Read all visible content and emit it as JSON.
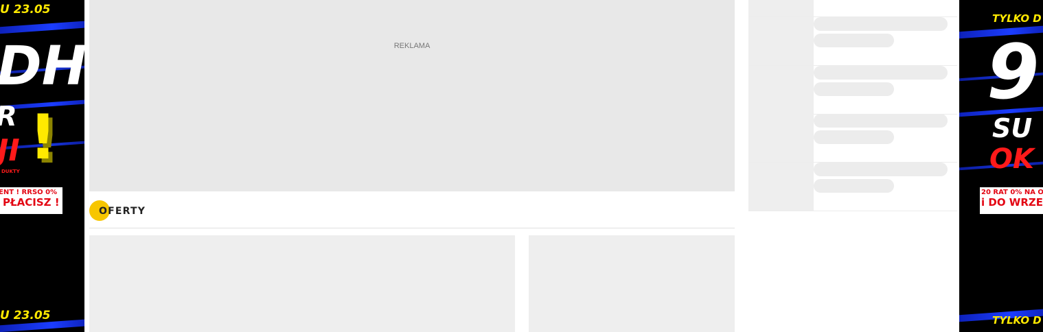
{
  "left_banner": {
    "date_top": "U 23.05",
    "headline_1": "DH",
    "headline_2": "R",
    "headline_3": "JI",
    "exclamation": "!",
    "small_text": "DUKTY",
    "promo_line_1": "ENT ! RRSO 0%",
    "promo_line_2": "PŁACISZ !",
    "date_bottom": "U 23.05"
  },
  "right_banner": {
    "date_top": "TYLKO D",
    "headline_1": "9",
    "headline_2": "SU",
    "headline_3": "OK",
    "promo_line_1": "20 RAT 0%  NA O",
    "promo_line_2": "i DO WRZE",
    "date_bottom": "TYLKO D"
  },
  "ad": {
    "label": "REKLAMA"
  },
  "section": {
    "title": "OFERTY"
  },
  "colors": {
    "banner_background": "#000000",
    "banner_yellow": "#ffe900",
    "banner_red": "#e30613",
    "banner_blue": "#1b3dff",
    "section_accent": "#f7c600",
    "placeholder_gray": "#e8e8e8"
  }
}
